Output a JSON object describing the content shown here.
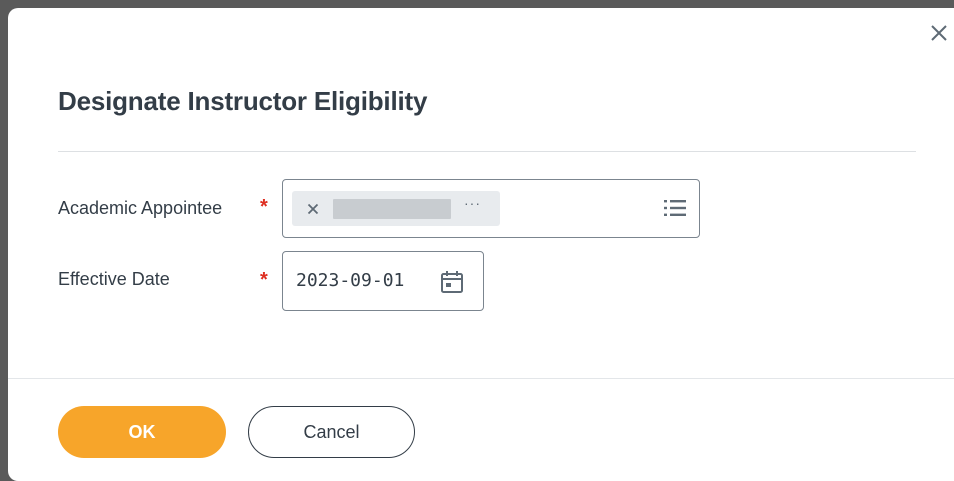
{
  "dialog": {
    "title": "Designate Instructor Eligibility",
    "close_icon": "close-icon"
  },
  "form": {
    "academic_appointee": {
      "label": "Academic Appointee",
      "required_mark": "*",
      "selected_value": "",
      "more_label": "···",
      "remove_icon": "close-icon",
      "prompt_icon": "list-icon"
    },
    "effective_date": {
      "label": "Effective Date",
      "required_mark": "*",
      "value": "2023-09-01",
      "calendar_icon": "calendar-icon"
    }
  },
  "footer": {
    "ok_label": "OK",
    "cancel_label": "Cancel"
  },
  "colors": {
    "primary_button": "#f7a52a",
    "required_star": "#de2e21",
    "text": "#333d47"
  }
}
